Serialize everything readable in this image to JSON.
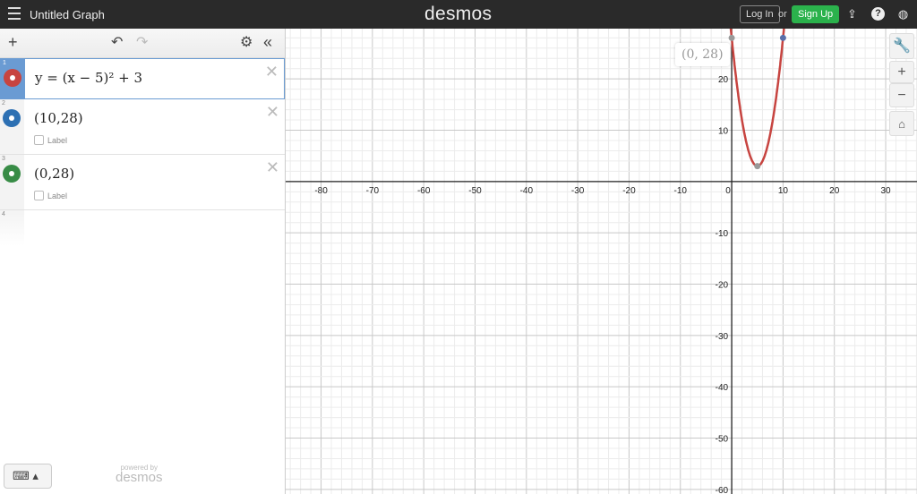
{
  "header": {
    "title": "Untitled Graph",
    "logo": "desmos",
    "login": "Log In",
    "or": "or",
    "signup": "Sign Up",
    "icons": [
      "share-icon",
      "help-icon",
      "language-icon"
    ]
  },
  "expressions": [
    {
      "num": "1",
      "latex": "y = (x − 5)² + 3",
      "color": "#c74440",
      "type": "curve"
    },
    {
      "num": "2",
      "latex": "(10,28)",
      "color": "#2d70b3",
      "type": "point",
      "label": "Label"
    },
    {
      "num": "3",
      "latex": "(0,28)",
      "color": "#388c46",
      "type": "point",
      "label": "Label"
    }
  ],
  "empty_num": "4",
  "footer": {
    "powered": "powered by",
    "brand": "desmos"
  },
  "tooltip": "(0, 28)",
  "graph": {
    "xmin": -86.9,
    "xmax": 36.1,
    "ymin": -60.9,
    "ymax": 29.8,
    "x_ticks": [
      "-80",
      "-70",
      "-60",
      "-50",
      "-40",
      "-30",
      "-20",
      "-10",
      "0",
      "10",
      "20",
      "30"
    ],
    "y_ticks": [
      "20",
      "10",
      "-10",
      "-20",
      "-30",
      "-40",
      "-50",
      "-60"
    ],
    "points": [
      {
        "x": 0,
        "y": 28,
        "color": "#999"
      },
      {
        "x": 10,
        "y": 28,
        "color": "#5a6fa8"
      },
      {
        "x": 5,
        "y": 3,
        "color": "#999"
      }
    ]
  }
}
